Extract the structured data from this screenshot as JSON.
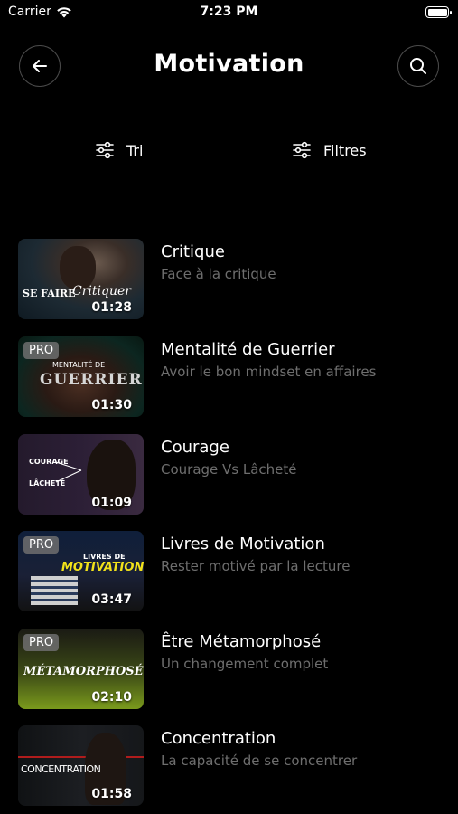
{
  "status_bar": {
    "carrier": "Carrier",
    "time": "7:23 PM"
  },
  "header": {
    "title": "Motivation"
  },
  "toolbar": {
    "sort_label": "Tri",
    "filter_label": "Filtres"
  },
  "videos": [
    {
      "title": "Critique",
      "subtitle": "Face à la critique",
      "duration": "01:28",
      "pro": false,
      "thumb_text_1": "SE FAIRE",
      "thumb_text_2": "Critiquer"
    },
    {
      "title": "Mentalité de Guerrier",
      "subtitle": "Avoir le bon mindset en affaires",
      "duration": "01:30",
      "pro": true,
      "pro_label": "PRO",
      "thumb_text_1": "MENTALITÉ DE",
      "thumb_text_2": "GUERRIER"
    },
    {
      "title": "Courage",
      "subtitle": "Courage Vs Lâcheté",
      "duration": "01:09",
      "pro": false,
      "thumb_text_1": "COURAGE",
      "thumb_text_2": "LÂCHETÉ"
    },
    {
      "title": "Livres de Motivation",
      "subtitle": "Rester motivé par la lecture",
      "duration": "03:47",
      "pro": true,
      "pro_label": "PRO",
      "thumb_text_1": "LIVRES DE",
      "thumb_text_2": "MOTIVATION"
    },
    {
      "title": "Être Métamorphosé",
      "subtitle": "Un changement complet",
      "duration": "02:10",
      "pro": true,
      "pro_label": "PRO",
      "thumb_text_1": "MÉTAMORPHOSÉ"
    },
    {
      "title": "Concentration",
      "subtitle": "La capacité de se concentrer",
      "duration": "01:58",
      "pro": false,
      "thumb_text_1": "CONCENTRATION"
    }
  ]
}
